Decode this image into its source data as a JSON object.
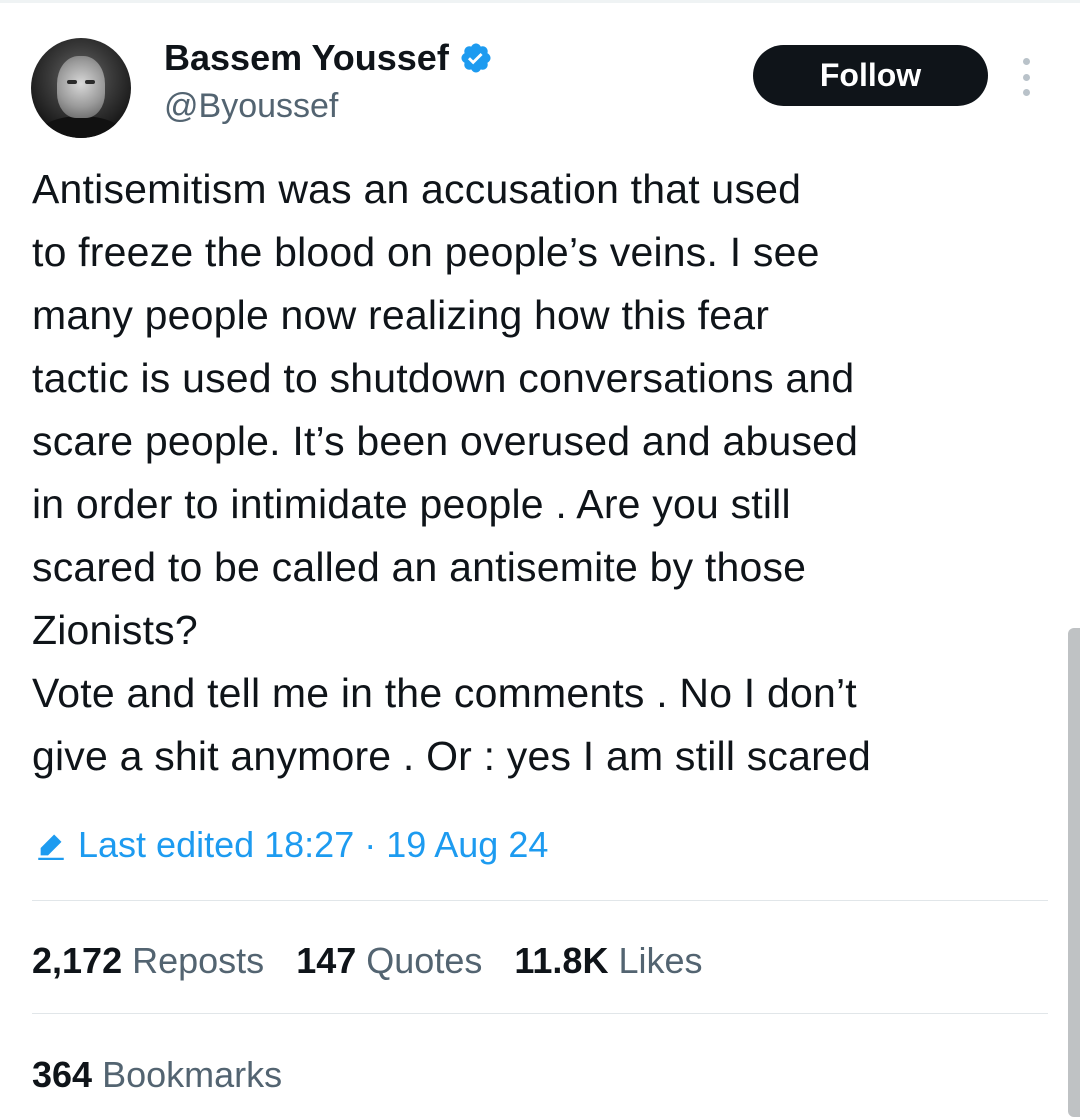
{
  "author": {
    "display_name": "Bassem Youssef",
    "handle": "@Byoussef",
    "verified": true
  },
  "follow_label": "Follow",
  "tweet": {
    "lines": [
      "Antisemitism was an accusation that used",
      "to freeze the blood on people’s veins. I see",
      "many people now realizing how this fear",
      "tactic is used to shutdown conversations and",
      "scare people. It’s been overused and abused",
      "in order to intimidate people . Are you still",
      "scared to be called an antisemite by those",
      "Zionists?",
      "Vote and tell me in the comments . No I don’t",
      "give a shit anymore . Or : yes I am still scared"
    ]
  },
  "edited": {
    "label": "Last edited 18:27 · 19 Aug 24"
  },
  "stats": {
    "reposts_count": "2,172",
    "reposts_label": "Reposts",
    "quotes_count": "147",
    "quotes_label": "Quotes",
    "likes_count": "11.8K",
    "likes_label": "Likes",
    "bookmarks_count": "364",
    "bookmarks_label": "Bookmarks"
  },
  "colors": {
    "accent": "#1d9bf0",
    "text": "#0f1419",
    "muted": "#536471",
    "button_bg": "#0f1419"
  },
  "icons": [
    "verified-badge-icon",
    "more-options-icon",
    "edit-pencil-icon"
  ]
}
